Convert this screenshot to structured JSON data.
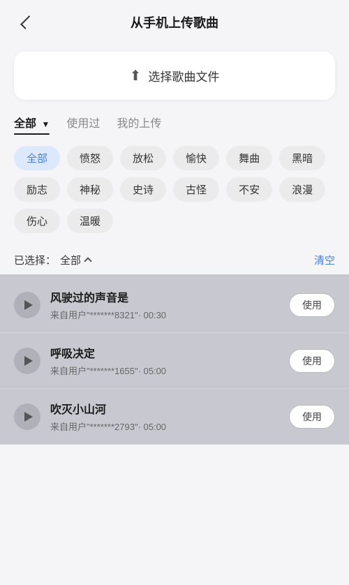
{
  "header": {
    "title": "从手机上传歌曲",
    "back_label": "返回"
  },
  "upload": {
    "label": "选择歌曲文件",
    "icon": "⬆"
  },
  "tabs": [
    {
      "id": "all",
      "label": "全部",
      "active": true,
      "filter": true
    },
    {
      "id": "used",
      "label": "使用过",
      "active": false
    },
    {
      "id": "my",
      "label": "我的上传",
      "active": false
    }
  ],
  "tags": [
    {
      "id": "all",
      "label": "全部",
      "active": true
    },
    {
      "id": "angry",
      "label": "愤怒",
      "active": false
    },
    {
      "id": "relax",
      "label": "放松",
      "active": false
    },
    {
      "id": "happy",
      "label": "愉快",
      "active": false
    },
    {
      "id": "dance",
      "label": "舞曲",
      "active": false
    },
    {
      "id": "dark",
      "label": "黑暗",
      "active": false
    },
    {
      "id": "motivate",
      "label": "励志",
      "active": false
    },
    {
      "id": "mystery",
      "label": "神秘",
      "active": false
    },
    {
      "id": "epic",
      "label": "史诗",
      "active": false
    },
    {
      "id": "weird",
      "label": "古怪",
      "active": false
    },
    {
      "id": "anxious",
      "label": "不安",
      "active": false
    },
    {
      "id": "romantic",
      "label": "浪漫",
      "active": false
    },
    {
      "id": "sad",
      "label": "伤心",
      "active": false
    },
    {
      "id": "warm",
      "label": "温暖",
      "active": false
    }
  ],
  "selected_bar": {
    "prefix": "已选择：",
    "value": "全部",
    "clear_label": "清空"
  },
  "songs": [
    {
      "id": 1,
      "title": "风驶过的声音是",
      "meta": "来自用户\"*******8321\"· 00:30",
      "use_label": "使用"
    },
    {
      "id": 2,
      "title": "呼吸决定",
      "meta": "来自用户\"*******1655\"· 05:00",
      "use_label": "使用"
    },
    {
      "id": 3,
      "title": "吹灭小山河",
      "meta": "来自用户\"*******2793\"· 05:00",
      "use_label": "使用"
    }
  ]
}
